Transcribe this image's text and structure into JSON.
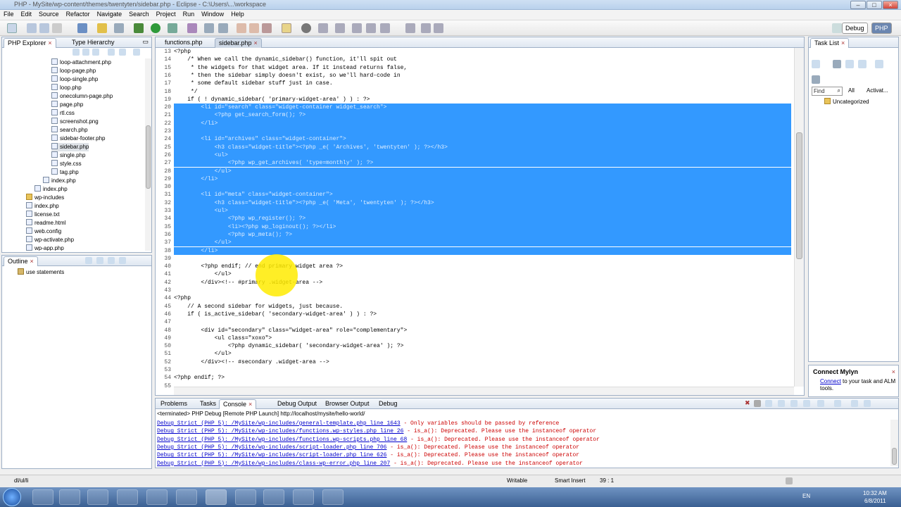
{
  "window": {
    "title": "PHP - MySite/wp-content/themes/twentyten/sidebar.php - Eclipse - C:\\Users\\...\\workspace",
    "min": "–",
    "max": "□",
    "close": "×"
  },
  "menu": [
    "File",
    "Edit",
    "Source",
    "Refactor",
    "Navigate",
    "Search",
    "Project",
    "Run",
    "Window",
    "Help"
  ],
  "perspectives": {
    "debug": "Debug",
    "php": "PHP"
  },
  "explorer": {
    "tabs": [
      "PHP Explorer",
      "Type Hierarchy"
    ],
    "items": [
      {
        "label": "loop-attachment.php",
        "icon": "file"
      },
      {
        "label": "loop-page.php",
        "icon": "file"
      },
      {
        "label": "loop-single.php",
        "icon": "file"
      },
      {
        "label": "loop.php",
        "icon": "file"
      },
      {
        "label": "onecolumn-page.php",
        "icon": "file"
      },
      {
        "label": "page.php",
        "icon": "file"
      },
      {
        "label": "rtl.css",
        "icon": "file"
      },
      {
        "label": "screenshot.png",
        "icon": "file"
      },
      {
        "label": "search.php",
        "icon": "file"
      },
      {
        "label": "sidebar-footer.php",
        "icon": "file"
      },
      {
        "label": "sidebar.php",
        "icon": "file"
      },
      {
        "label": "single.php",
        "icon": "file"
      },
      {
        "label": "style.css",
        "icon": "file"
      },
      {
        "label": "tag.php",
        "icon": "file"
      },
      {
        "label": "index.php",
        "icon": "file"
      },
      {
        "label": "index.php",
        "icon": "file"
      },
      {
        "label": "wp-includes",
        "icon": "folder"
      },
      {
        "label": "index.php",
        "icon": "file"
      },
      {
        "label": "license.txt",
        "icon": "file"
      },
      {
        "label": "readme.html",
        "icon": "file"
      },
      {
        "label": "web.config",
        "icon": "file"
      },
      {
        "label": "wp-activate.php",
        "icon": "file"
      },
      {
        "label": "wp-app.php",
        "icon": "file"
      }
    ]
  },
  "outline": {
    "tab": "Outline",
    "items": [
      "use statements"
    ]
  },
  "editor": {
    "tabs": [
      "functions.php",
      "sidebar.php"
    ],
    "lines": [
      {
        "n": "13",
        "text": "<?php",
        "sel": false
      },
      {
        "n": "14",
        "text": "    /* When we call the dynamic_sidebar() function, it'll spit out",
        "sel": false
      },
      {
        "n": "15",
        "text": "     * the widgets for that widget area. If it instead returns false,",
        "sel": false
      },
      {
        "n": "16",
        "text": "     * then the sidebar simply doesn't exist, so we'll hard-code in",
        "sel": false
      },
      {
        "n": "17",
        "text": "     * some default sidebar stuff just in case.",
        "sel": false
      },
      {
        "n": "18",
        "text": "     */",
        "sel": false
      },
      {
        "n": "19",
        "text": "    if ( ! dynamic_sidebar( 'primary-widget-area' ) ) : ?>",
        "sel": false
      },
      {
        "n": "20",
        "text": "        <li id=\"search\" class=\"widget-container widget_search\">",
        "sel": true
      },
      {
        "n": "21",
        "text": "            <?php get_search_form(); ?>",
        "sel": true
      },
      {
        "n": "22",
        "text": "        </li>",
        "sel": true
      },
      {
        "n": "23",
        "text": "",
        "sel": true
      },
      {
        "n": "24",
        "text": "        <li id=\"archives\" class=\"widget-container\">",
        "sel": true
      },
      {
        "n": "25",
        "text": "            <h3 class=\"widget-title\"><?php _e( 'Archives', 'twentyten' ); ?></h3>",
        "sel": true
      },
      {
        "n": "26",
        "text": "            <ul>",
        "sel": true
      },
      {
        "n": "27",
        "text": "                <?php wp_get_archives( 'type=monthly' ); ?>",
        "sel": true
      },
      {
        "n": "28",
        "text": "            </ul>",
        "sel": true
      },
      {
        "n": "29",
        "text": "        </li>",
        "sel": true
      },
      {
        "n": "30",
        "text": "",
        "sel": true
      },
      {
        "n": "31",
        "text": "        <li id=\"meta\" class=\"widget-container\">",
        "sel": true
      },
      {
        "n": "32",
        "text": "            <h3 class=\"widget-title\"><?php _e( 'Meta', 'twentyten' ); ?></h3>",
        "sel": true
      },
      {
        "n": "33",
        "text": "            <ul>",
        "sel": true
      },
      {
        "n": "34",
        "text": "                <?php wp_register(); ?>",
        "sel": true
      },
      {
        "n": "35",
        "text": "                <li><?php wp_loginout(); ?></li>",
        "sel": true
      },
      {
        "n": "36",
        "text": "                <?php wp_meta(); ?>",
        "sel": true
      },
      {
        "n": "37",
        "text": "            </ul>",
        "sel": true
      },
      {
        "n": "38",
        "text": "        </li>",
        "sel": true
      },
      {
        "n": "39",
        "text": "",
        "sel": false
      },
      {
        "n": "40",
        "text": "        <?php endif; // end primary widget area ?>",
        "sel": false
      },
      {
        "n": "41",
        "text": "            </ul>",
        "sel": false
      },
      {
        "n": "42",
        "text": "        </div><!-- #primary .widget-area -->",
        "sel": false
      },
      {
        "n": "43",
        "text": "",
        "sel": false
      },
      {
        "n": "44",
        "text": "<?php",
        "sel": false
      },
      {
        "n": "45",
        "text": "    // A second sidebar for widgets, just because.",
        "sel": false
      },
      {
        "n": "46",
        "text": "    if ( is_active_sidebar( 'secondary-widget-area' ) ) : ?>",
        "sel": false
      },
      {
        "n": "47",
        "text": "",
        "sel": false
      },
      {
        "n": "48",
        "text": "        <div id=\"secondary\" class=\"widget-area\" role=\"complementary\">",
        "sel": false
      },
      {
        "n": "49",
        "text": "            <ul class=\"xoxo\">",
        "sel": false
      },
      {
        "n": "50",
        "text": "                <?php dynamic_sidebar( 'secondary-widget-area' ); ?>",
        "sel": false
      },
      {
        "n": "51",
        "text": "            </ul>",
        "sel": false
      },
      {
        "n": "52",
        "text": "        </div><!-- #secondary .widget-area -->",
        "sel": false
      },
      {
        "n": "53",
        "text": "",
        "sel": false
      },
      {
        "n": "54",
        "text": "<?php endif; ?>",
        "sel": false
      },
      {
        "n": "55",
        "text": "",
        "sel": false
      }
    ]
  },
  "tasklist": {
    "tab": "Task List",
    "find_placeholder": "Find",
    "all": "All",
    "activate": "Activat...",
    "category": "Uncategorized"
  },
  "mylyn": {
    "title": "Connect Mylyn",
    "link": "Connect",
    "text": " to your task and ALM tools."
  },
  "bottom": {
    "tabs": [
      "Problems",
      "Tasks",
      "Console",
      "Debug Output",
      "Browser Output",
      "Debug"
    ],
    "header": "<terminated> PHP Debug [Remote PHP Launch] http://localhost/mysite/hello-world/",
    "lines": [
      {
        "link": "Debug Strict (PHP 5): /MySite/wp-includes/general-template.php line 1643",
        "msg": " - Only variables should be passed by reference"
      },
      {
        "link": "Debug Strict (PHP 5): /MySite/wp-includes/functions.wp-styles.php line 26",
        "msg": " - is_a(): Deprecated. Please use the instanceof operator"
      },
      {
        "link": "Debug Strict (PHP 5): /MySite/wp-includes/functions.wp-scripts.php line 68",
        "msg": " - is_a(): Deprecated. Please use the instanceof operator"
      },
      {
        "link": "Debug Strict (PHP 5): /MySite/wp-includes/script-loader.php line 706",
        "msg": " - is_a(): Deprecated. Please use the instanceof operator"
      },
      {
        "link": "Debug Strict (PHP 5): /MySite/wp-includes/script-loader.php line 626",
        "msg": " - is_a(): Deprecated. Please use the instanceof operator"
      },
      {
        "link": "Debug Strict (PHP 5): /MySite/wp-includes/class-wp-error.php line 207",
        "msg": " - is_a(): Deprecated. Please use the instanceof operator"
      }
    ]
  },
  "status": {
    "left": "dl/ul/li",
    "writable": "Writable",
    "insert": "Smart Insert",
    "position": "39 : 1"
  },
  "taskbar": {
    "time": "10:32 AM",
    "date": "6/8/2011",
    "lang": "EN"
  }
}
